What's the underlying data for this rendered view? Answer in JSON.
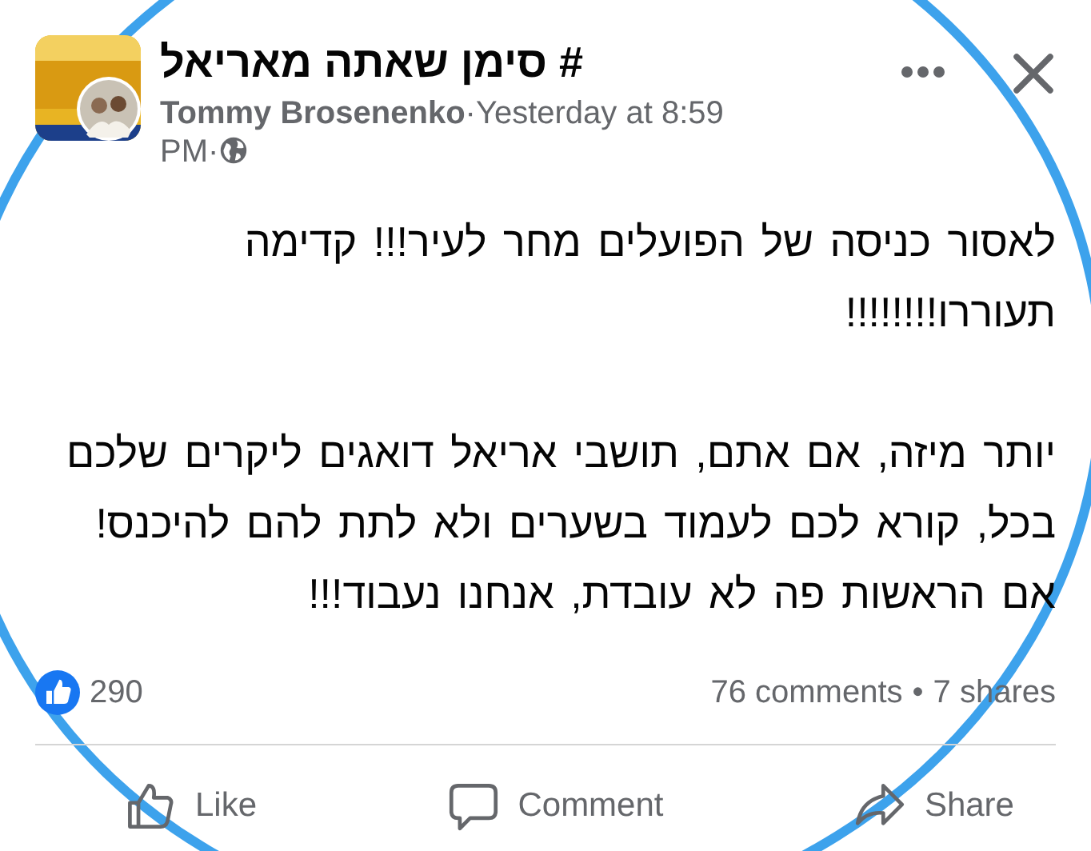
{
  "post": {
    "group_name": "# סימן שאתה מאריאל",
    "author": "Tommy Brosenenko",
    "separator": "·",
    "time": "Yesterday at 8:59",
    "time_continued": "PM",
    "audience_separator": "·"
  },
  "body": {
    "paragraphs": [
      "לאסור כניסה של הפועלים מחר לעיר!!! קדימה תעוררו!!!!!!!!",
      "יותר מיזה, אם אתם, תושבי אריאל דואגים ליקרים שלכם בכל, קורא לכם לעמוד בשערים ולא לתת להם להיכנס! אם הראשות פה לא עובדת, אנחנו נעבוד!!!"
    ]
  },
  "stats": {
    "reactions": "290",
    "comments": "76 comments",
    "dot": "•",
    "shares": "7 shares"
  },
  "actions": {
    "like": "Like",
    "comment": "Comment",
    "share": "Share"
  }
}
